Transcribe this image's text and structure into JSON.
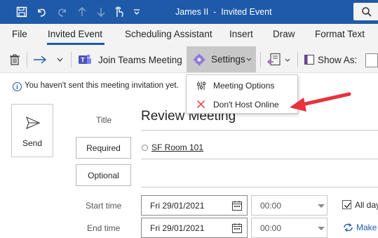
{
  "titlebar": {
    "title": "James II  -  Invited Event",
    "icons": [
      "save-icon",
      "undo-icon",
      "redo-icon",
      "up-arrow-icon",
      "down-arrow-icon",
      "touch-mode-icon",
      "customize-icon",
      "search-icon"
    ]
  },
  "tabs": [
    {
      "label": "File"
    },
    {
      "label": "Invited Event",
      "active": true
    },
    {
      "label": "Scheduling Assistant"
    },
    {
      "label": "Insert"
    },
    {
      "label": "Draw"
    },
    {
      "label": "Format Text"
    }
  ],
  "toolbar": {
    "join_teams_label": "Join Teams Meeting",
    "settings_label": "Settings",
    "show_as_label": "Show As:"
  },
  "info": {
    "text": "You haven't sent this meeting invitation yet."
  },
  "send": {
    "label": "Send"
  },
  "form": {
    "title_label": "Title",
    "title_value": "Review Meeting",
    "required_label": "Required",
    "optional_label": "Optional",
    "attendee": "SF Room 101",
    "start_label": "Start time",
    "end_label": "End time",
    "start_date": "Fri 29/01/2021",
    "end_date": "Fri 29/01/2021",
    "start_time": "00:00",
    "end_time": "00:00",
    "all_day_label": "All day",
    "all_day_checked": true,
    "make_recurring_label": "Make"
  },
  "settings_menu": {
    "items": [
      {
        "label": "Meeting Options",
        "icon": "meeting-options-icon"
      },
      {
        "label": "Don't Host Online",
        "icon": "close-x-icon"
      }
    ]
  },
  "colors": {
    "titlebar": "#1e5aa8",
    "accent": "#1e5aa8",
    "annotation_arrow": "#e8323c"
  }
}
